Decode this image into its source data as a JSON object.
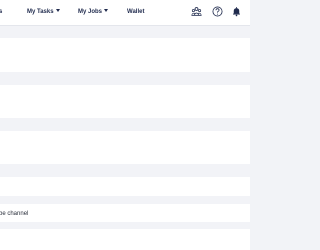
{
  "header": {
    "partial_item": "s",
    "my_tasks": "My Tasks",
    "my_jobs": "My Jobs",
    "wallet": "Wallet",
    "icons": [
      "team-icon",
      "help-icon",
      "bell-icon"
    ]
  },
  "content": {
    "channel_text": "be channel"
  },
  "colors": {
    "nav_text": "#1f2a4d",
    "background": "#f2f3f7",
    "panel": "#ffffff"
  }
}
